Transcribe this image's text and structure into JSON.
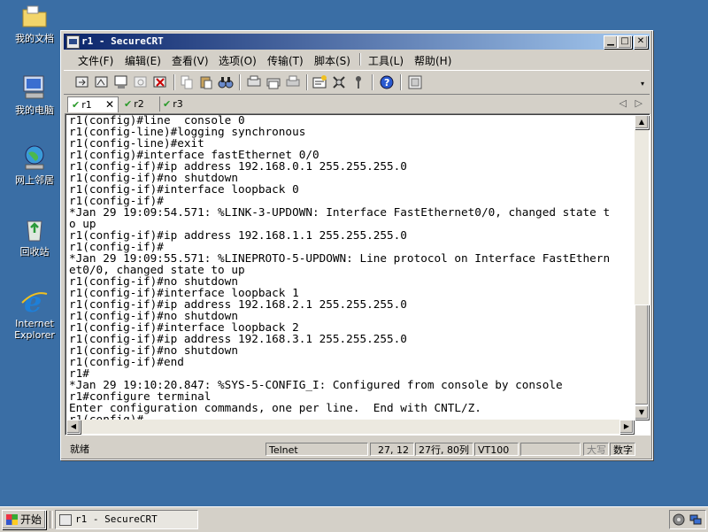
{
  "desktop": {
    "icons": [
      {
        "name": "my-documents",
        "label": "我的文档"
      },
      {
        "name": "my-computer",
        "label": "我的电脑"
      },
      {
        "name": "network-places",
        "label": "网上邻居"
      },
      {
        "name": "recycle-bin",
        "label": "回收站"
      },
      {
        "name": "internet-explorer",
        "label": "Internet Explorer"
      }
    ]
  },
  "window": {
    "title": "r1 - SecureCRT",
    "menu": [
      "文件(F)",
      "编辑(E)",
      "查看(V)",
      "选项(O)",
      "传输(T)",
      "脚本(S)",
      "工具(L)",
      "帮助(H)"
    ],
    "tabs": [
      {
        "label": "r1",
        "active": true
      },
      {
        "label": "r2",
        "active": false
      },
      {
        "label": "r3",
        "active": false
      }
    ],
    "terminal_lines": [
      "r1(config)#line  console 0",
      "r1(config-line)#logging synchronous",
      "r1(config-line)#exit",
      "r1(config)#interface fastEthernet 0/0",
      "r1(config-if)#ip address 192.168.0.1 255.255.255.0",
      "r1(config-if)#no shutdown",
      "r1(config-if)#interface loopback 0",
      "r1(config-if)#",
      "*Jan 29 19:09:54.571: %LINK-3-UPDOWN: Interface FastEthernet0/0, changed state t",
      "o up",
      "r1(config-if)#ip address 192.168.1.1 255.255.255.0",
      "r1(config-if)#",
      "*Jan 29 19:09:55.571: %LINEPROTO-5-UPDOWN: Line protocol on Interface FastEthern",
      "et0/0, changed state to up",
      "r1(config-if)#no shutdown",
      "r1(config-if)#interface loopback 1",
      "r1(config-if)#ip address 192.168.2.1 255.255.255.0",
      "r1(config-if)#no shutdown",
      "r1(config-if)#interface loopback 2",
      "r1(config-if)#ip address 192.168.3.1 255.255.255.0",
      "r1(config-if)#no shutdown",
      "r1(config-if)#end",
      "r1#",
      "*Jan 29 19:10:20.847: %SYS-5-CONFIG_I: Configured from console by console",
      "r1#configure terminal",
      "Enter configuration commands, one per line.  End with CNTL/Z.",
      "r1(config)#"
    ],
    "status": {
      "ready": "就绪",
      "protocol": "Telnet",
      "cursor": "27, 12",
      "size": "27行, 80列",
      "emulation": "VT100",
      "caps": "大写",
      "num": "数字"
    }
  },
  "taskbar": {
    "start_label": "开始",
    "task_label": "r1 - SecureCRT"
  }
}
